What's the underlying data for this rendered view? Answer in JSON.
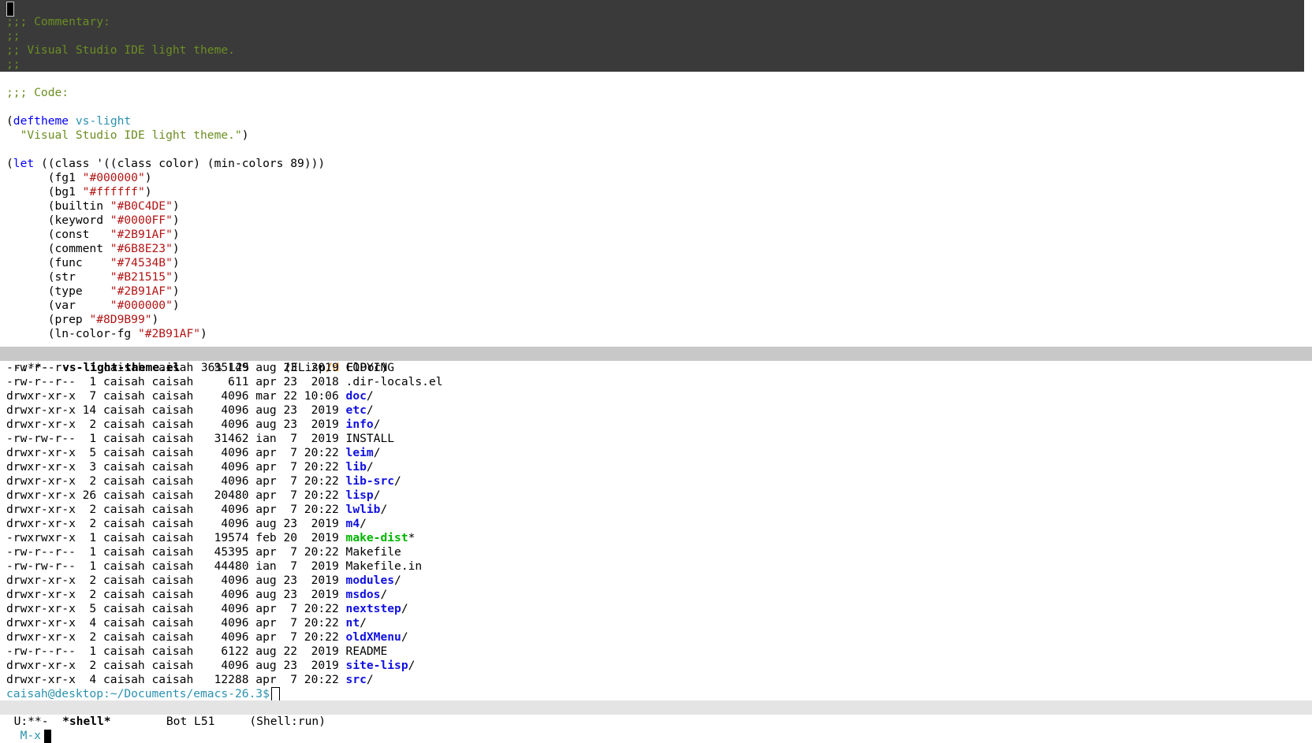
{
  "colors": {
    "comment": "#6b8e23",
    "keyword": "#0000ff",
    "const": "#2b91af",
    "str": "#b21515",
    "dir": "#1010e0",
    "exec": "#00b400"
  },
  "code": {
    "commentary_lines": [
      ";;; Commentary:",
      ";;",
      ";; Visual Studio IDE light theme.",
      ";;"
    ],
    "code_header": ";;; Code:",
    "deftheme": {
      "open": "(",
      "keyword": "deftheme",
      "name": "vs-light"
    },
    "doc_line": {
      "indent": "  ",
      "text": "\"Visual Studio IDE light theme.\"",
      "close": ")"
    },
    "let_line": {
      "open": "(",
      "keyword": "let",
      "rest": " ((class '((class color) (min-colors 89)))"
    },
    "bindings": [
      {
        "prefix": "      (fg1 ",
        "value": "\"#000000\"",
        "suffix": ")"
      },
      {
        "prefix": "      (bg1 ",
        "value": "\"#ffffff\"",
        "suffix": ")"
      },
      {
        "prefix": "      (builtin ",
        "value": "\"#B0C4DE\"",
        "suffix": ")"
      },
      {
        "prefix": "      (keyword ",
        "value": "\"#0000FF\"",
        "suffix": ")"
      },
      {
        "prefix": "      (const   ",
        "value": "\"#2B91AF\"",
        "suffix": ")"
      },
      {
        "prefix": "      (comment ",
        "value": "\"#6B8E23\"",
        "suffix": ")"
      },
      {
        "prefix": "      (func    ",
        "value": "\"#74534B\"",
        "suffix": ")"
      },
      {
        "prefix": "      (str     ",
        "value": "\"#B21515\"",
        "suffix": ")"
      },
      {
        "prefix": "      (type    ",
        "value": "\"#2B91AF\"",
        "suffix": ")"
      },
      {
        "prefix": "      (var     ",
        "value": "\"#000000\"",
        "suffix": ")"
      },
      {
        "prefix": "      (prep ",
        "value": "\"#8D9B99\"",
        "suffix": ")"
      },
      {
        "prefix": "      (ln-color-fg ",
        "value": "\"#2B91AF\"",
        "suffix": ")"
      }
    ]
  },
  "modeline_top": {
    "status": "-:**-  ",
    "buffer": "vs-light-theme.el",
    "position": "   36% L25     ",
    "mode_open": "(ELisp",
    "mode_slash": "/d",
    "mode_rest": " ElDoc)"
  },
  "shell": {
    "listing": [
      {
        "info": "-rw-r--r--  1 caisah caisah   35149 aug 23  2019 ",
        "name": "COPYING",
        "type": "file",
        "suffix": ""
      },
      {
        "info": "-rw-r--r--  1 caisah caisah     611 apr 23  2018 ",
        "name": ".dir-locals.el",
        "type": "file",
        "suffix": ""
      },
      {
        "info": "drwxr-xr-x  7 caisah caisah    4096 mar 22 10:06 ",
        "name": "doc",
        "type": "dir",
        "suffix": "/"
      },
      {
        "info": "drwxr-xr-x 14 caisah caisah    4096 aug 23  2019 ",
        "name": "etc",
        "type": "dir",
        "suffix": "/"
      },
      {
        "info": "drwxr-xr-x  2 caisah caisah    4096 aug 23  2019 ",
        "name": "info",
        "type": "dir",
        "suffix": "/"
      },
      {
        "info": "-rw-rw-r--  1 caisah caisah   31462 ian  7  2019 ",
        "name": "INSTALL",
        "type": "file",
        "suffix": ""
      },
      {
        "info": "drwxr-xr-x  5 caisah caisah    4096 apr  7 20:22 ",
        "name": "leim",
        "type": "dir",
        "suffix": "/"
      },
      {
        "info": "drwxr-xr-x  3 caisah caisah    4096 apr  7 20:22 ",
        "name": "lib",
        "type": "dir",
        "suffix": "/"
      },
      {
        "info": "drwxr-xr-x  2 caisah caisah    4096 apr  7 20:22 ",
        "name": "lib-src",
        "type": "dir",
        "suffix": "/"
      },
      {
        "info": "drwxr-xr-x 26 caisah caisah   20480 apr  7 20:22 ",
        "name": "lisp",
        "type": "dir",
        "suffix": "/"
      },
      {
        "info": "drwxr-xr-x  2 caisah caisah    4096 apr  7 20:22 ",
        "name": "lwlib",
        "type": "dir",
        "suffix": "/"
      },
      {
        "info": "drwxr-xr-x  2 caisah caisah    4096 aug 23  2019 ",
        "name": "m4",
        "type": "dir",
        "suffix": "/"
      },
      {
        "info": "-rwxrwxr-x  1 caisah caisah   19574 feb 20  2019 ",
        "name": "make-dist",
        "type": "exec",
        "suffix": "*"
      },
      {
        "info": "-rw-r--r--  1 caisah caisah   45395 apr  7 20:22 ",
        "name": "Makefile",
        "type": "file",
        "suffix": ""
      },
      {
        "info": "-rw-rw-r--  1 caisah caisah   44480 ian  7  2019 ",
        "name": "Makefile.in",
        "type": "file",
        "suffix": ""
      },
      {
        "info": "drwxr-xr-x  2 caisah caisah    4096 aug 23  2019 ",
        "name": "modules",
        "type": "dir",
        "suffix": "/"
      },
      {
        "info": "drwxr-xr-x  2 caisah caisah    4096 aug 23  2019 ",
        "name": "msdos",
        "type": "dir",
        "suffix": "/"
      },
      {
        "info": "drwxr-xr-x  5 caisah caisah    4096 apr  7 20:22 ",
        "name": "nextstep",
        "type": "dir",
        "suffix": "/"
      },
      {
        "info": "drwxr-xr-x  4 caisah caisah    4096 apr  7 20:22 ",
        "name": "nt",
        "type": "dir",
        "suffix": "/"
      },
      {
        "info": "drwxr-xr-x  2 caisah caisah    4096 apr  7 20:22 ",
        "name": "oldXMenu",
        "type": "dir",
        "suffix": "/"
      },
      {
        "info": "-rw-r--r--  1 caisah caisah    6122 aug 22  2019 ",
        "name": "README",
        "type": "file",
        "suffix": ""
      },
      {
        "info": "drwxr-xr-x  2 caisah caisah    4096 aug 23  2019 ",
        "name": "site-lisp",
        "type": "dir",
        "suffix": "/"
      },
      {
        "info": "drwxr-xr-x  4 caisah caisah   12288 apr  7 20:22 ",
        "name": "src",
        "type": "dir",
        "suffix": "/"
      }
    ],
    "prompt": "caisah@desktop:~/Documents/emacs-26.3$"
  },
  "modeline_bottom": {
    "status": "U:**-  ",
    "buffer": "*shell*",
    "position": "        Bot L51     ",
    "mode": "(Shell:run)"
  },
  "minibuffer": {
    "prompt": "M-x"
  }
}
